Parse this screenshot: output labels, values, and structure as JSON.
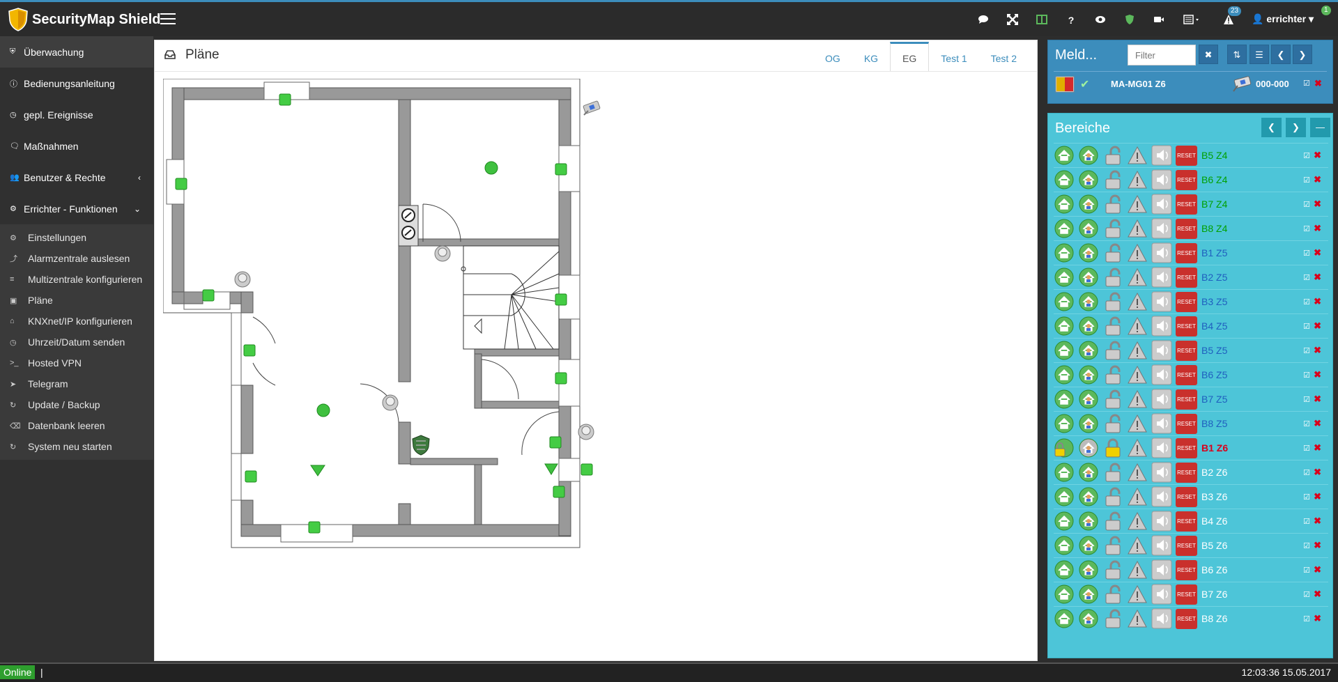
{
  "app": {
    "brand": "SecurityMap Shield"
  },
  "topbar": {
    "icons": [
      "comment-icon",
      "fullscreen-icon",
      "columns-icon",
      "help-icon",
      "eye-icon",
      "shield-icon",
      "video-icon",
      "list-dropdown-icon",
      "alert-icon"
    ],
    "alert_count": "23",
    "user_badge": "1",
    "user": "errichter"
  },
  "sidebar": {
    "main_items": [
      {
        "label": "Überwachung",
        "icon": "shield-icon",
        "active": true
      },
      {
        "label": "Bedienungsanleitung",
        "icon": "info-icon"
      },
      {
        "label": "gepl. Ereignisse",
        "icon": "clock-icon"
      },
      {
        "label": "Maßnahmen",
        "icon": "comment-icon"
      },
      {
        "label": "Benutzer & Rechte",
        "icon": "users-icon",
        "chevron": "‹"
      },
      {
        "label": "Errichter - Funktionen",
        "icon": "cogs-icon",
        "chevron": "⌄"
      }
    ],
    "sub_items": [
      {
        "label": "Einstellungen",
        "icon": "cogs-icon"
      },
      {
        "label": "Alarmzentrale auslesen",
        "icon": "compress-icon"
      },
      {
        "label": "Multizentrale konfigurieren",
        "icon": "server-icon"
      },
      {
        "label": "Pläne",
        "icon": "image-icon"
      },
      {
        "label": "KNXnet/IP konfigurieren",
        "icon": "home-icon"
      },
      {
        "label": "Uhrzeit/Datum senden",
        "icon": "clock-icon"
      },
      {
        "label": "Hosted VPN",
        "icon": "terminal-icon"
      },
      {
        "label": "Telegram",
        "icon": "paper-plane-icon"
      },
      {
        "label": "Update / Backup",
        "icon": "refresh-icon"
      },
      {
        "label": "Datenbank leeren",
        "icon": "eraser-icon"
      },
      {
        "label": "System neu starten",
        "icon": "restart-icon"
      }
    ]
  },
  "main": {
    "title": "Pläne",
    "tabs": [
      "OG",
      "KG",
      "EG",
      "Test 1",
      "Test 2"
    ],
    "active_tab": "EG"
  },
  "meldungen": {
    "title": "Meld...",
    "filter_placeholder": "Filter",
    "row": {
      "name": "MA-MG01 Z6",
      "code": "000-000"
    }
  },
  "bereiche": {
    "title": "Bereiche",
    "rows": [
      {
        "label": "B5 Z4",
        "color": "#00a000"
      },
      {
        "label": "B6 Z4",
        "color": "#00a000"
      },
      {
        "label": "B7 Z4",
        "color": "#00a000"
      },
      {
        "label": "B8 Z4",
        "color": "#00a000"
      },
      {
        "label": "B1 Z5",
        "color": "#1f5fbf"
      },
      {
        "label": "B2 Z5",
        "color": "#1f5fbf"
      },
      {
        "label": "B3 Z5",
        "color": "#1f5fbf"
      },
      {
        "label": "B4 Z5",
        "color": "#1f5fbf"
      },
      {
        "label": "B5 Z5",
        "color": "#1f5fbf"
      },
      {
        "label": "B6 Z5",
        "color": "#1f5fbf"
      },
      {
        "label": "B7 Z5",
        "color": "#1f5fbf"
      },
      {
        "label": "B8 Z5",
        "color": "#1f5fbf"
      },
      {
        "label": "B1 Z6",
        "color": "#d9001b",
        "armed": true
      },
      {
        "label": "B2 Z6",
        "color": "#ffffff"
      },
      {
        "label": "B3 Z6",
        "color": "#ffffff"
      },
      {
        "label": "B4 Z6",
        "color": "#ffffff"
      },
      {
        "label": "B5 Z6",
        "color": "#ffffff"
      },
      {
        "label": "B6 Z6",
        "color": "#ffffff"
      },
      {
        "label": "B7 Z6",
        "color": "#ffffff"
      },
      {
        "label": "B8 Z6",
        "color": "#ffffff"
      }
    ],
    "reset_label": "RESET"
  },
  "status": {
    "online": "Online",
    "cursor": "|",
    "clock": "12:03:36 15.05.2017"
  }
}
